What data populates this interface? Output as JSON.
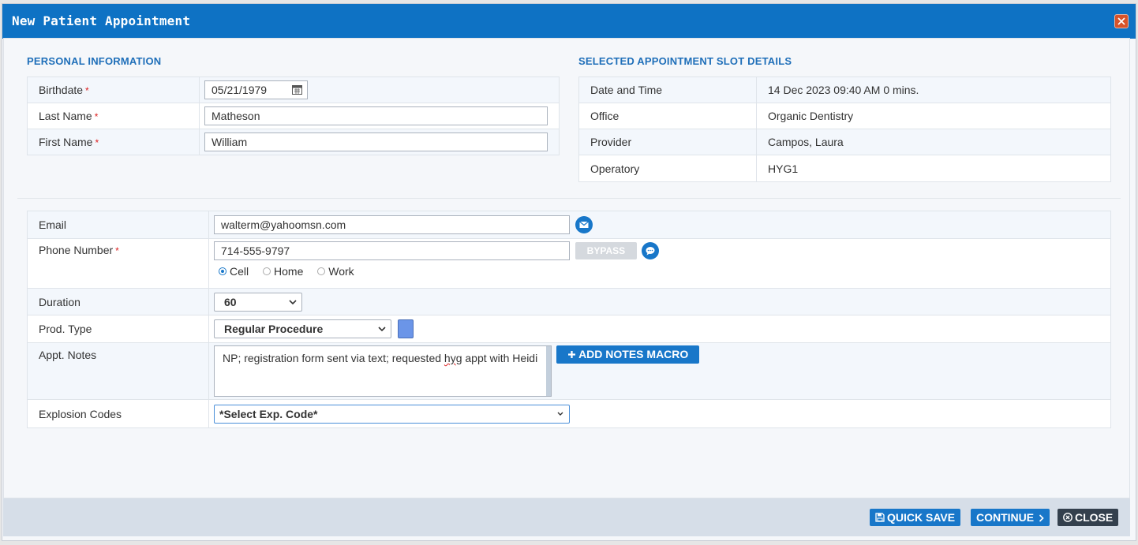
{
  "dialog": {
    "title": "New Patient Appointment"
  },
  "personal": {
    "section_title": "PERSONAL INFORMATION",
    "birthdate_label": "Birthdate",
    "birthdate_value": "05/21/1979",
    "last_name_label": "Last Name",
    "last_name_value": "Matheson",
    "first_name_label": "First Name",
    "first_name_value": "William",
    "required_mark": "*"
  },
  "slot": {
    "section_title": "SELECTED APPOINTMENT SLOT DETAILS",
    "rows": [
      {
        "label": "Date and Time",
        "value": "14 Dec 2023 09:40 AM 0 mins."
      },
      {
        "label": "Office",
        "value": "Organic Dentistry"
      },
      {
        "label": "Provider",
        "value": "Campos, Laura"
      },
      {
        "label": "Operatory",
        "value": "HYG1"
      }
    ]
  },
  "contact": {
    "email_label": "Email",
    "email_value": "walterm@yahoomsn.com",
    "phone_label": "Phone Number",
    "phone_value": "714-555-9797",
    "bypass_label": "BYPASS",
    "phone_types": [
      "Cell",
      "Home",
      "Work"
    ],
    "phone_type_selected": "Cell",
    "duration_label": "Duration",
    "duration_value": "60",
    "prod_type_label": "Prod. Type",
    "prod_type_value": "Regular Procedure",
    "prod_type_color": "#6b95e8",
    "notes_label": "Appt. Notes",
    "notes_before": "NP; registration form sent via text; requested ",
    "notes_misspelled": "hyg",
    "notes_after": " appt with Heidi",
    "add_macro_label": "ADD NOTES MACRO",
    "explosion_label": "Explosion Codes",
    "explosion_value": "*Select Exp. Code*"
  },
  "footer": {
    "quick_save_label": "QUICK SAVE",
    "continue_label": "CONTINUE",
    "close_label": "CLOSE"
  },
  "colors": {
    "primary": "#1877c9",
    "titlebar": "#0e72c4",
    "close_button": "#34404d",
    "close_x": "#d8532a"
  }
}
